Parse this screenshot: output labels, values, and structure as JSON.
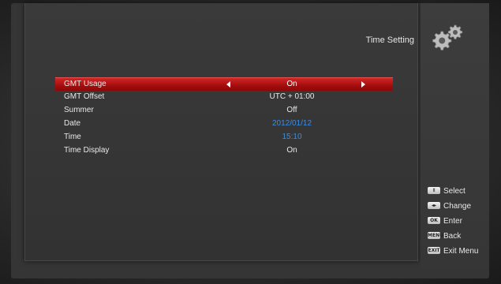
{
  "header": {
    "title": "Time Setting",
    "icon": "gear-icon"
  },
  "menu": {
    "selected_index": 0,
    "rows": [
      {
        "label": "GMT Usage",
        "value": "On",
        "color": "#ffffff"
      },
      {
        "label": "GMT Offset",
        "value": "UTC + 01:00",
        "color": "#e8e8e8"
      },
      {
        "label": "Summer",
        "value": "Off",
        "color": "#e8e8e8"
      },
      {
        "label": "Date",
        "value": "2012/01/12",
        "color": "#3c8de0"
      },
      {
        "label": "Time",
        "value": "15:10",
        "color": "#3c8de0"
      },
      {
        "label": "Time Display",
        "value": "On",
        "color": "#e8e8e8"
      }
    ]
  },
  "legend": [
    {
      "key": "up-down-key-icon",
      "label": "Select"
    },
    {
      "key": "left-right-key-icon",
      "label": "Change"
    },
    {
      "key": "ok-key-icon",
      "key_text": "OK",
      "label": "Enter"
    },
    {
      "key": "menu-key-icon",
      "key_text": "MENU",
      "label": "Back"
    },
    {
      "key": "exit-key-icon",
      "key_text": "EXIT",
      "label": "Exit Menu"
    }
  ],
  "colors": {
    "highlight": "#c41a1a",
    "accent_blue": "#3c8de0"
  }
}
